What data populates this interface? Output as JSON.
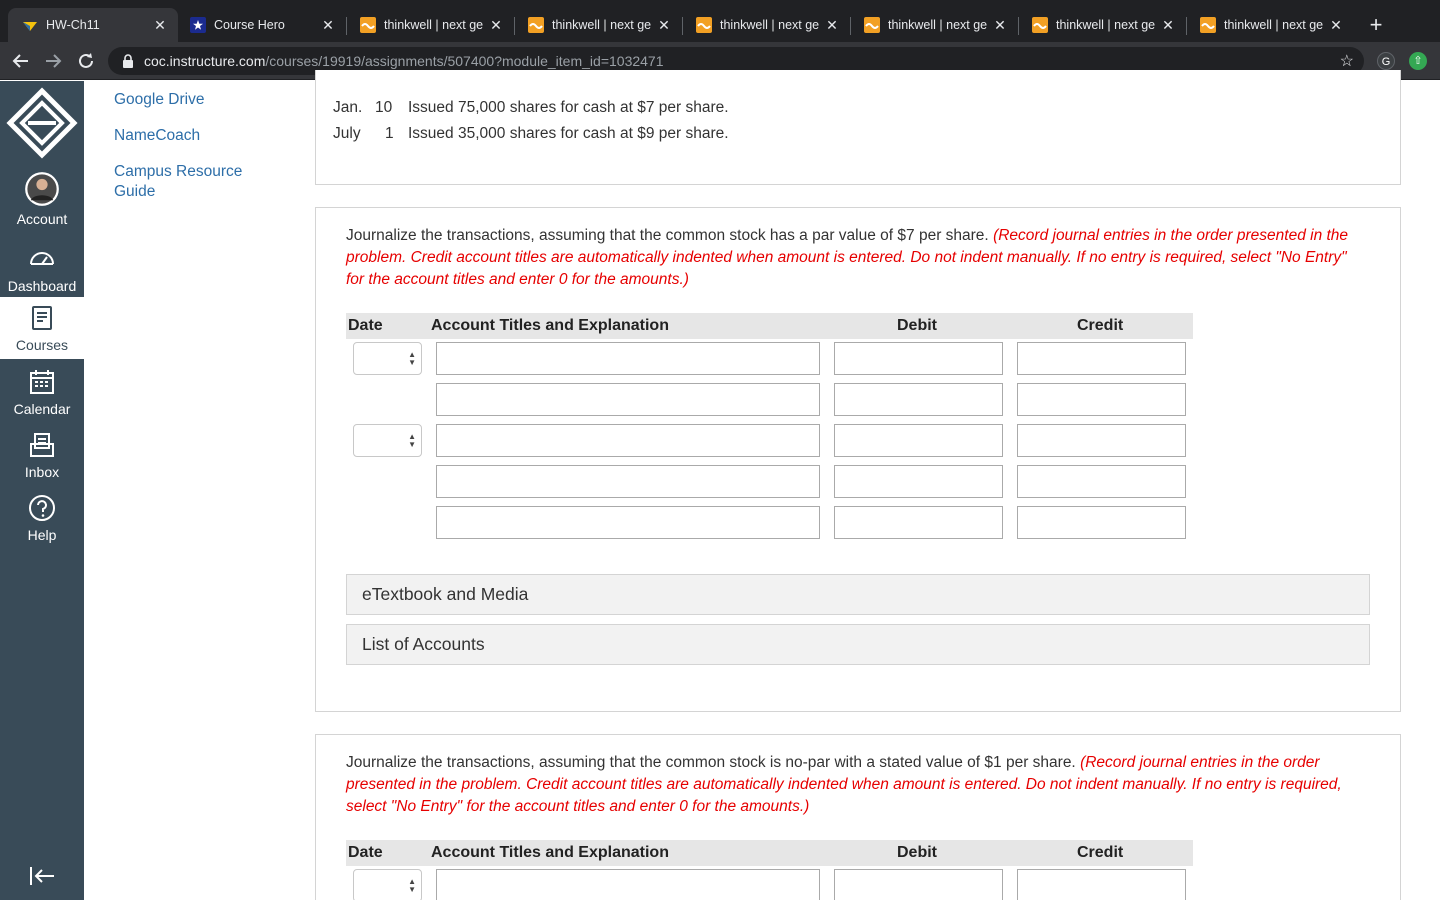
{
  "browser": {
    "tabs": [
      {
        "label": "HW-Ch11",
        "icon": "canvas-icon",
        "active": true
      },
      {
        "label": "Course Hero",
        "icon": "coursehero-icon",
        "active": false
      },
      {
        "label": "thinkwell | next ge",
        "icon": "thinkwell-icon",
        "active": false
      },
      {
        "label": "thinkwell | next ge",
        "icon": "thinkwell-icon",
        "active": false
      },
      {
        "label": "thinkwell | next ge",
        "icon": "thinkwell-icon",
        "active": false
      },
      {
        "label": "thinkwell | next ge",
        "icon": "thinkwell-icon",
        "active": false
      },
      {
        "label": "thinkwell | next ge",
        "icon": "thinkwell-icon",
        "active": false
      },
      {
        "label": "thinkwell | next ge",
        "icon": "thinkwell-icon",
        "active": false
      }
    ],
    "url_host": "coc.instructure.com",
    "url_path": "/courses/19919/assignments/507400?module_item_id=1032471",
    "ext_g_label": "G"
  },
  "global_nav": {
    "items": [
      {
        "label": "Account",
        "icon": "avatar-icon"
      },
      {
        "label": "Dashboard",
        "icon": "dashboard-icon"
      },
      {
        "label": "Courses",
        "icon": "courses-icon",
        "active": true
      },
      {
        "label": "Calendar",
        "icon": "calendar-icon"
      },
      {
        "label": "Inbox",
        "icon": "inbox-icon"
      },
      {
        "label": "Help",
        "icon": "help-icon"
      }
    ]
  },
  "course_nav": {
    "links": [
      "Google Drive",
      "NameCoach",
      "Campus Resource Guide"
    ]
  },
  "transactions": [
    {
      "month": "Jan.",
      "day": "10",
      "desc": "Issued 75,000 shares for cash at $7 per share."
    },
    {
      "month": "July",
      "day": "1",
      "desc": "Issued 35,000 shares for cash at $9 per share."
    }
  ],
  "part_a": {
    "prompt": "Journalize the transactions, assuming that the common stock has a par value of $7 per share.",
    "instruction": "(Record journal entries in the order presented in the problem. Credit account titles are automatically indented when amount is entered. Do not indent manually. If no entry is required, select \"No Entry\" for the account titles and enter 0 for the amounts.)"
  },
  "part_b": {
    "prompt": "Journalize the transactions, assuming that the common stock is no-par with a stated value of $1 per share.",
    "instruction": "(Record journal entries in the order presented in the problem. Credit account titles are automatically indented when amount is entered. Do not indent manually. If no entry is required, select \"No Entry\" for the account titles and enter 0 for the amounts.)"
  },
  "journal_headers": {
    "date": "Date",
    "account": "Account Titles and Explanation",
    "debit": "Debit",
    "credit": "Credit"
  },
  "accordions": {
    "etextbook": "eTextbook and Media",
    "accounts": "List of Accounts"
  },
  "colors": {
    "nav_bg": "#394b58",
    "link": "#2d6ea8",
    "instruction": "#e60000"
  }
}
